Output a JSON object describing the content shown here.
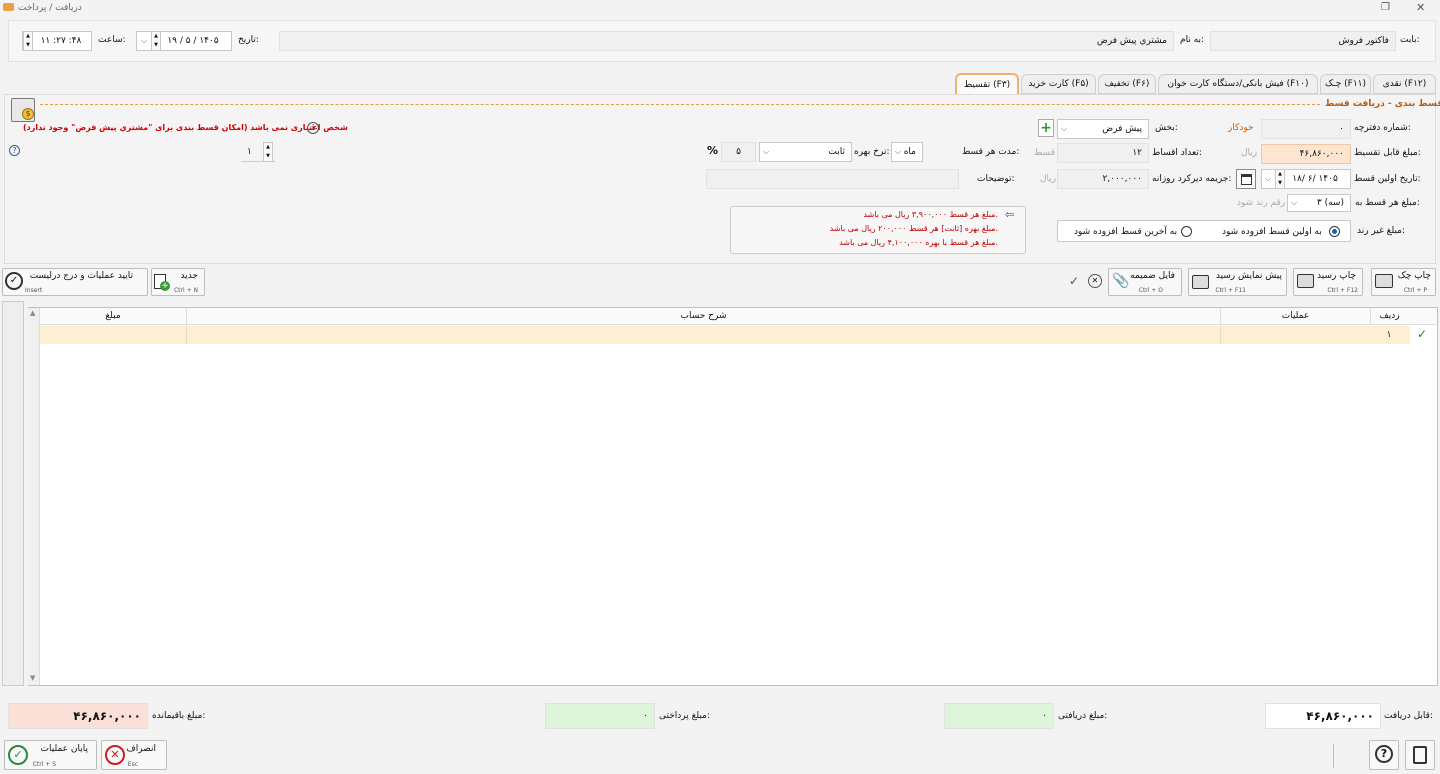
{
  "window": {
    "title": "دریافت / پرداخت"
  },
  "header": {
    "babat_label": "بابت:",
    "babat_value": "فاکتور فروش",
    "beh_name_label": "به نام:",
    "beh_name_value": "مشتري پيش فرض",
    "date_label": "تاریخ:",
    "date_value": "۱۹ / ۵ / ۱۴۰۵",
    "time_label": "ساعت:",
    "time_value": "۱۱ :۲۷ :۴۸"
  },
  "tabs": [
    "نقدی (F۱۲)",
    "چـک (F۱۱)",
    "فیش بانکی/دستگاه کارت خوان (F۱۰)",
    "تخفیف (F۶)",
    "کارت خرید (F۵)",
    "تقسیط (F۳)"
  ],
  "panel": {
    "title": "قسط بندی - دریافت قسط",
    "warning": "شخص اعتباری نمی باشد (امکان قسط بندی برای \"مشتري پيش فرض\" وجود ندارد)",
    "notebook_label": "شماره دفترچه:",
    "notebook_value": "۰",
    "auto_label": "خودکار",
    "section_label": "بخش:",
    "section_value": "پیش فرض",
    "amount_label": "مبلغ قابل تقسیط:",
    "amount_value": "۴۶,۸۶۰,۰۰۰",
    "rial": "ریال",
    "count_label": "تعداد اقساط:",
    "count_value": "۱۲",
    "qest": "قسط",
    "duration_label": "مدت هر قسط:",
    "duration_unit": "ماه",
    "interest_label": "نرخ بهره:",
    "interest_type": "ثابت",
    "interest_value": "۵",
    "percent": "%",
    "spin_value": "۱",
    "first_date_label": "تاریخ اولین قسط:",
    "first_date_value": "۱۸/ ۶/ ۱۴۰۵",
    "penalty_label": "جریمه دیرکرد روزانه:",
    "penalty_value": "۲,۰۰۰,۰۰۰",
    "penalty_rial": "ریال",
    "desc_label": "توضیحات:",
    "round_label": "مبلغ هر قسط به:",
    "round_value": "۳ (سه)",
    "round_suffix": "رقم رند شود",
    "nonround_label": "مبلغ غیر رند:",
    "radio1": "به اولین قسط افزوده شود",
    "radio2": "به آخرین قسط افزوده شود",
    "info_lines": [
      "مبلغ هر قسط ۳,۹۰۰,۰۰۰ ریال می باشد.",
      "مبلغ بهره [ثابت] هر قسط ۲۰۰,۰۰۰ ریال می باشد.",
      "مبلغ هر قسط با بهره ۴,۱۰۰,۰۰۰ ریال می باشد."
    ]
  },
  "toolbar": {
    "print_check": "چاپ چک",
    "print_check_key": "Ctrl + P",
    "print_receipt": "چاپ رسید",
    "print_receipt_key": "Ctrl + F12",
    "preview_receipt": "پیش نمایش رسید",
    "preview_receipt_key": "Ctrl + F11",
    "attach_file": "فایل ضمیمه",
    "attach_file_key": "Ctrl + O",
    "new": "جدید",
    "new_key": "Ctrl + N",
    "confirm": "تایید عملیات و درج درلیست",
    "confirm_key": "Insert"
  },
  "table": {
    "headers": [
      "ردیف",
      "عملیات",
      "شرح حساب",
      "مبلغ"
    ],
    "rows": [
      [
        "۱",
        "",
        "",
        ""
      ]
    ]
  },
  "footer": {
    "receivable_label": "قابل دریافت:",
    "receivable_value": "۴۶,۸۶۰,۰۰۰",
    "received_label": "مبلغ دریافتی:",
    "received_value": "۰",
    "paid_label": "مبلغ پرداختی:",
    "paid_value": "۰",
    "remaining_label": "مبلغ باقیمانده:",
    "remaining_value": "۴۶,۸۶۰,۰۰۰",
    "finish": "پایان عملیات",
    "finish_key": "Ctrl + S",
    "cancel": "انصراف",
    "cancel_key": "Esc"
  }
}
